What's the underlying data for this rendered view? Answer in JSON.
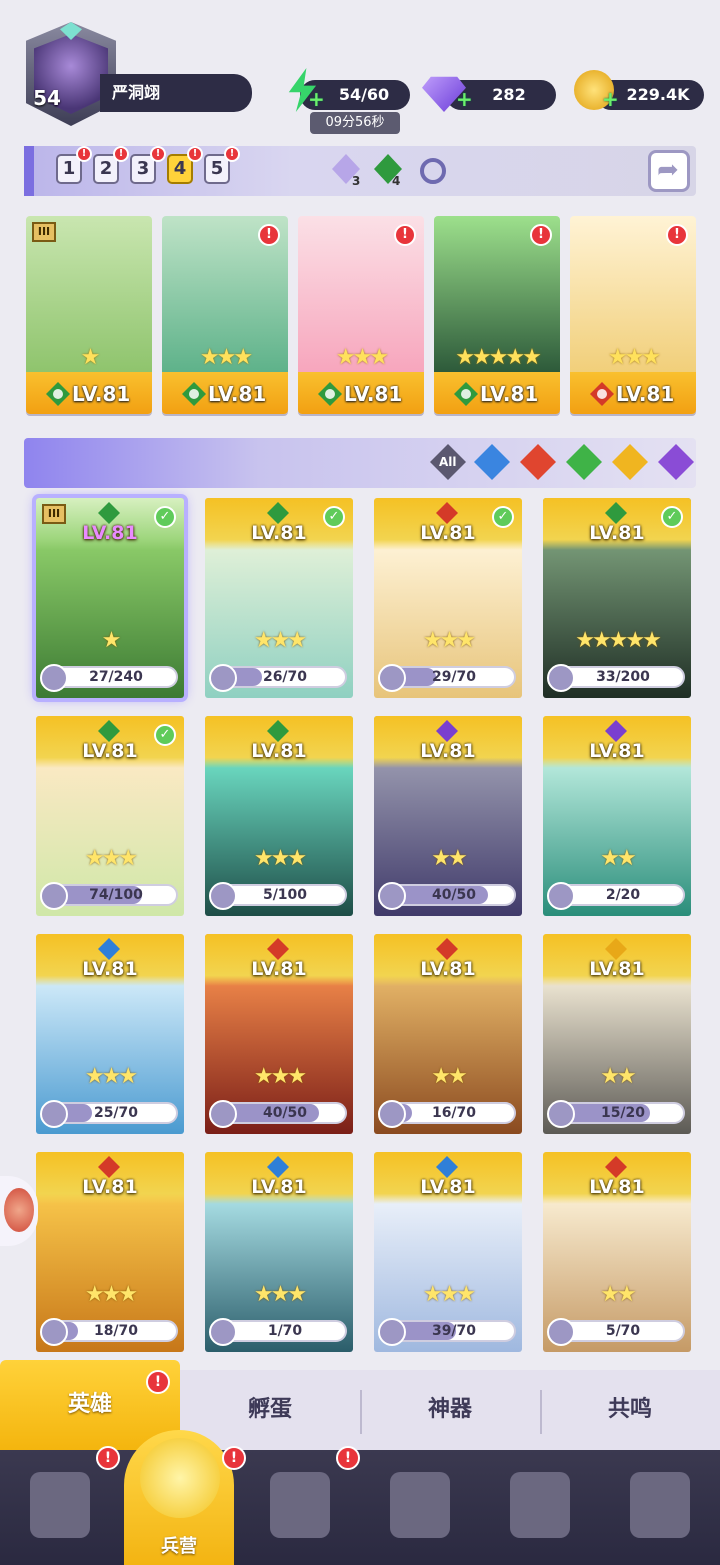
{
  "player": {
    "level": "54",
    "name": "严洞翊"
  },
  "resources": {
    "energy": "54/60",
    "energy_timer": "09分56秒",
    "gems": "282",
    "coins": "229.4K"
  },
  "team_tabs": [
    "1",
    "2",
    "3",
    "4",
    "5"
  ],
  "team_tab_active": "4",
  "counters": {
    "purple": "3",
    "green": "4"
  },
  "team_slots": [
    {
      "level": "LV.81",
      "element": "green",
      "stars": "★",
      "roman": "III",
      "colors": [
        "#c9e6b0",
        "#8fc46d"
      ]
    },
    {
      "level": "LV.81",
      "element": "green",
      "stars": "★★★",
      "colors": [
        "#bfe3c7",
        "#5eb28a"
      ]
    },
    {
      "level": "LV.81",
      "element": "green",
      "stars": "★★★",
      "colors": [
        "#fbe0e6",
        "#f7a6bd"
      ]
    },
    {
      "level": "LV.81",
      "element": "green",
      "stars": "★★★★★",
      "colors": [
        "#9de08c",
        "#2d5a3a"
      ]
    },
    {
      "level": "LV.81",
      "element": "red",
      "stars": "★★★",
      "colors": [
        "#fff3d5",
        "#f1cf7a"
      ]
    }
  ],
  "filters": {
    "all_label": "All",
    "elements": [
      "#3a85e0",
      "#e0452f",
      "#3fb347",
      "#f0b520",
      "#8a4cd6"
    ]
  },
  "heroes": [
    {
      "level": "LV.81",
      "element": "green",
      "check": true,
      "stars": "★",
      "shards": "27/240",
      "fill": 0.11,
      "bg": [
        "#8fcf6b",
        "#3c7a33"
      ],
      "selected": true,
      "roman": "III"
    },
    {
      "level": "LV.81",
      "element": "green",
      "check": true,
      "stars": "★★★",
      "shards": "26/70",
      "fill": 0.37,
      "bg": [
        "#e5f2d9",
        "#8fd0c1"
      ]
    },
    {
      "level": "LV.81",
      "element": "red",
      "check": true,
      "stars": "★★★",
      "shards": "29/70",
      "fill": 0.41,
      "bg": [
        "#fff4da",
        "#e7c47a"
      ]
    },
    {
      "level": "LV.81",
      "element": "green",
      "check": true,
      "stars": "★★★★★",
      "shards": "33/200",
      "fill": 0.17,
      "bg": [
        "#7a9d7a",
        "#1f2e25"
      ]
    },
    {
      "level": "LV.81",
      "element": "green",
      "check": true,
      "stars": "★★★",
      "shards": "74/100",
      "fill": 0.74,
      "bg": [
        "#fde9c5",
        "#cfe7a8"
      ]
    },
    {
      "level": "LV.81",
      "element": "green",
      "check": false,
      "stars": "★★★",
      "shards": "5/100",
      "fill": 0.05,
      "bg": [
        "#6fe0c7",
        "#1e4d47"
      ]
    },
    {
      "level": "LV.81",
      "element": "purple",
      "check": false,
      "stars": "★★",
      "shards": "40/50",
      "fill": 0.8,
      "bg": [
        "#9a9ab0",
        "#403a6a"
      ]
    },
    {
      "level": "LV.81",
      "element": "purple",
      "check": false,
      "stars": "★★",
      "shards": "2/20",
      "fill": 0.1,
      "bg": [
        "#bdeee1",
        "#2a8d7a"
      ]
    },
    {
      "level": "LV.81",
      "element": "blue",
      "check": false,
      "stars": "★★★",
      "shards": "25/70",
      "fill": 0.36,
      "bg": [
        "#d6eefb",
        "#4a9ad0"
      ]
    },
    {
      "level": "LV.81",
      "element": "red",
      "check": false,
      "stars": "★★★",
      "shards": "40/50",
      "fill": 0.8,
      "bg": [
        "#f0884a",
        "#7a1e18"
      ]
    },
    {
      "level": "LV.81",
      "element": "red",
      "check": false,
      "stars": "★★",
      "shards": "16/70",
      "fill": 0.23,
      "bg": [
        "#e8b86a",
        "#8a4a20"
      ]
    },
    {
      "level": "LV.81",
      "element": "yellow",
      "check": false,
      "stars": "★★",
      "shards": "15/20",
      "fill": 0.75,
      "bg": [
        "#f4ecd8",
        "#5c5a55"
      ]
    },
    {
      "level": "LV.81",
      "element": "red",
      "check": false,
      "stars": "★★★",
      "shards": "18/70",
      "fill": 0.26,
      "bg": [
        "#f9c84c",
        "#c77719"
      ]
    },
    {
      "level": "LV.81",
      "element": "blue",
      "check": false,
      "stars": "★★★",
      "shards": "1/70",
      "fill": 0.02,
      "bg": [
        "#aee4ea",
        "#2b5d6a"
      ]
    },
    {
      "level": "LV.81",
      "element": "blue",
      "check": false,
      "stars": "★★★",
      "shards": "39/70",
      "fill": 0.56,
      "bg": [
        "#eef3fb",
        "#9fb8df"
      ]
    },
    {
      "level": "LV.81",
      "element": "red",
      "check": false,
      "stars": "★★",
      "shards": "5/70",
      "fill": 0.07,
      "bg": [
        "#fbf0d6",
        "#c59a66"
      ]
    }
  ],
  "sub_tabs": [
    "英雄",
    "孵蛋",
    "神器",
    "共鸣"
  ],
  "sub_tab_active": "英雄",
  "nav": {
    "active_label": "兵营"
  },
  "element_colors": {
    "green": "#2f9a3e",
    "red": "#d43a28",
    "blue": "#2f7fd8",
    "purple": "#7a3fcf",
    "yellow": "#e8a818"
  }
}
